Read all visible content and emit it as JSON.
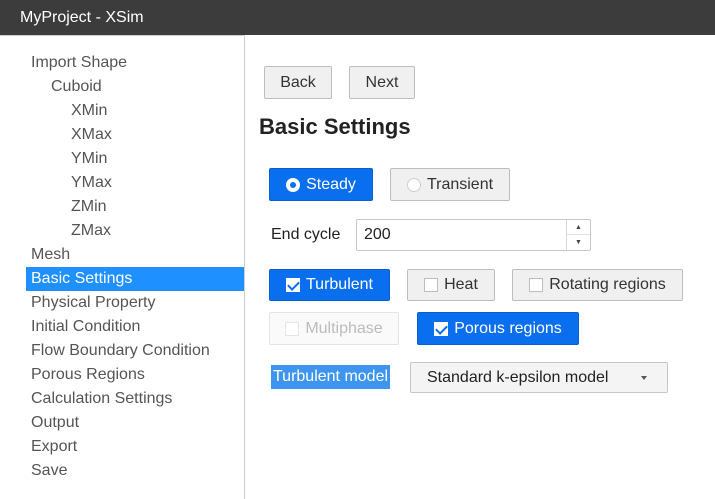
{
  "window": {
    "title": "MyProject - XSim"
  },
  "sidebar": {
    "items": [
      {
        "label": "Import Shape",
        "level": 1
      },
      {
        "label": "Cuboid",
        "level": 2
      },
      {
        "label": "XMin",
        "level": 3
      },
      {
        "label": "XMax",
        "level": 3
      },
      {
        "label": "YMin",
        "level": 3
      },
      {
        "label": "YMax",
        "level": 3
      },
      {
        "label": "ZMin",
        "level": 3
      },
      {
        "label": "ZMax",
        "level": 3
      },
      {
        "label": "Mesh",
        "level": 1
      },
      {
        "label": "Basic Settings",
        "level": 1,
        "active": true
      },
      {
        "label": "Physical Property",
        "level": 1
      },
      {
        "label": "Initial Condition",
        "level": 1
      },
      {
        "label": "Flow Boundary Condition",
        "level": 1
      },
      {
        "label": "Porous Regions",
        "level": 1
      },
      {
        "label": "Calculation Settings",
        "level": 1
      },
      {
        "label": "Output",
        "level": 1
      },
      {
        "label": "Export",
        "level": 1
      },
      {
        "label": "Save",
        "level": 1
      }
    ]
  },
  "nav": {
    "back_label": "Back",
    "next_label": "Next"
  },
  "page": {
    "title": "Basic Settings"
  },
  "time_mode": {
    "steady_label": "Steady",
    "steady_selected": true,
    "transient_label": "Transient",
    "transient_selected": false
  },
  "end_cycle": {
    "label": "End cycle",
    "value": "200"
  },
  "options": {
    "turbulent_label": "Turbulent",
    "turbulent_checked": true,
    "heat_label": "Heat",
    "heat_checked": false,
    "rotating_label": "Rotating regions",
    "rotating_checked": false,
    "multiphase_label": "Multiphase",
    "multiphase_checked": false,
    "multiphase_disabled": true,
    "porous_label": "Porous regions",
    "porous_checked": true
  },
  "turbulent_model": {
    "label": "Turbulent model",
    "selected": "Standard k-epsilon model"
  },
  "colors": {
    "accent": "#0a6fef",
    "sidebar_active": "#1e90ff",
    "titlebar": "#3c3c3c",
    "label_highlight": "#3d95f0"
  }
}
